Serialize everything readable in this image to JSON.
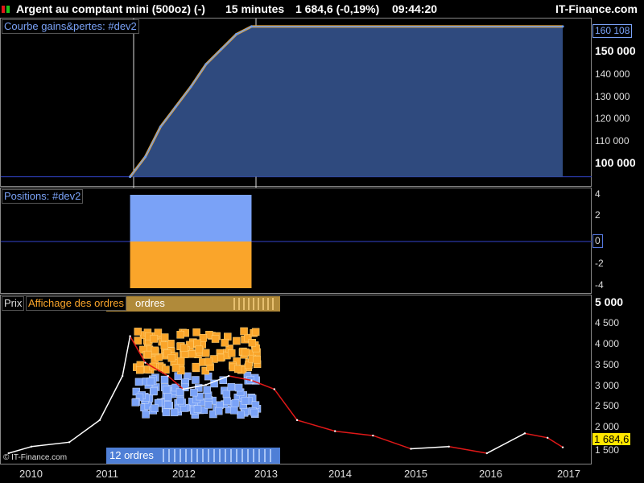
{
  "header": {
    "title": "Argent au comptant mini (500oz) (-)",
    "timeframe": "15 minutes",
    "price_change": "1 684,6 (-0,19%)",
    "time": "09:44:20",
    "brand": "IT-Finance.com"
  },
  "colors": {
    "equity_fill": "#2f4a7e",
    "equity_line": "#6b9cf0",
    "equity_top": "#f5a623",
    "long": "#7aa2f7",
    "short": "#faa52a",
    "price_up": "#ffffff",
    "price_down": "#e01818",
    "baseline": "#3344cc"
  },
  "panels": {
    "equity": {
      "label": "Courbe gains&pertes: #dev2",
      "current_value": "160 108",
      "ticks": [
        "150 000",
        "140 000",
        "130 000",
        "120 000",
        "110 000",
        "100 000"
      ]
    },
    "positions": {
      "label": "Positions: #dev2",
      "current_value": "0",
      "ticks": [
        "4",
        "2",
        "-2",
        "-4"
      ]
    },
    "price": {
      "label": "Prix",
      "orders_label": "Affichage des ordres",
      "sell_summary": "ordres",
      "buy_summary": "12 ordres",
      "current_value": "1 684,6",
      "ticks": [
        "5 000",
        "4 500",
        "4 000",
        "3 500",
        "3 000",
        "2 500",
        "2 000",
        "1 500"
      ],
      "copyright": "© IT-Finance.com"
    }
  },
  "x_axis": [
    "2010",
    "2011",
    "2012",
    "2013",
    "2014",
    "2015",
    "2016",
    "2017"
  ],
  "chart_data": [
    {
      "type": "area",
      "title": "Courbe gains&pertes: #dev2",
      "x": [
        "2011.3",
        "2011.5",
        "2011.7",
        "2011.9",
        "2012.1",
        "2012.3",
        "2012.5",
        "2012.7",
        "2012.9",
        "2017.0"
      ],
      "series": [
        {
          "values": [
            100000,
            108000,
            120000,
            128000,
            136000,
            145000,
            151000,
            157000,
            160108,
            160108
          ]
        }
      ],
      "ylim": [
        97000,
        162000
      ]
    },
    {
      "type": "bar",
      "title": "Positions: #dev2",
      "series": [
        {
          "name": "long",
          "values": [
            4
          ]
        },
        {
          "name": "short",
          "values": [
            -4
          ]
        }
      ],
      "x_range": [
        "2011.3",
        "2012.9"
      ],
      "ylim": [
        -4,
        4
      ]
    },
    {
      "type": "line",
      "title": "Prix",
      "x": [
        "2009.7",
        "2010.0",
        "2010.5",
        "2010.9",
        "2011.2",
        "2011.3",
        "2011.5",
        "2011.8",
        "2012.0",
        "2012.3",
        "2012.6",
        "2012.9",
        "2013.2",
        "2013.5",
        "2014.0",
        "2014.5",
        "2015.0",
        "2015.5",
        "2016.0",
        "2016.5",
        "2016.8",
        "2017.0"
      ],
      "series": [
        {
          "values": [
            1550,
            1700,
            1800,
            2300,
            3300,
            4200,
            3600,
            3300,
            3000,
            3100,
            3300,
            3200,
            3000,
            2300,
            2050,
            1950,
            1650,
            1700,
            1550,
            2000,
            1900,
            1684.6
          ]
        }
      ],
      "ylim": [
        1350,
        5050
      ]
    }
  ]
}
